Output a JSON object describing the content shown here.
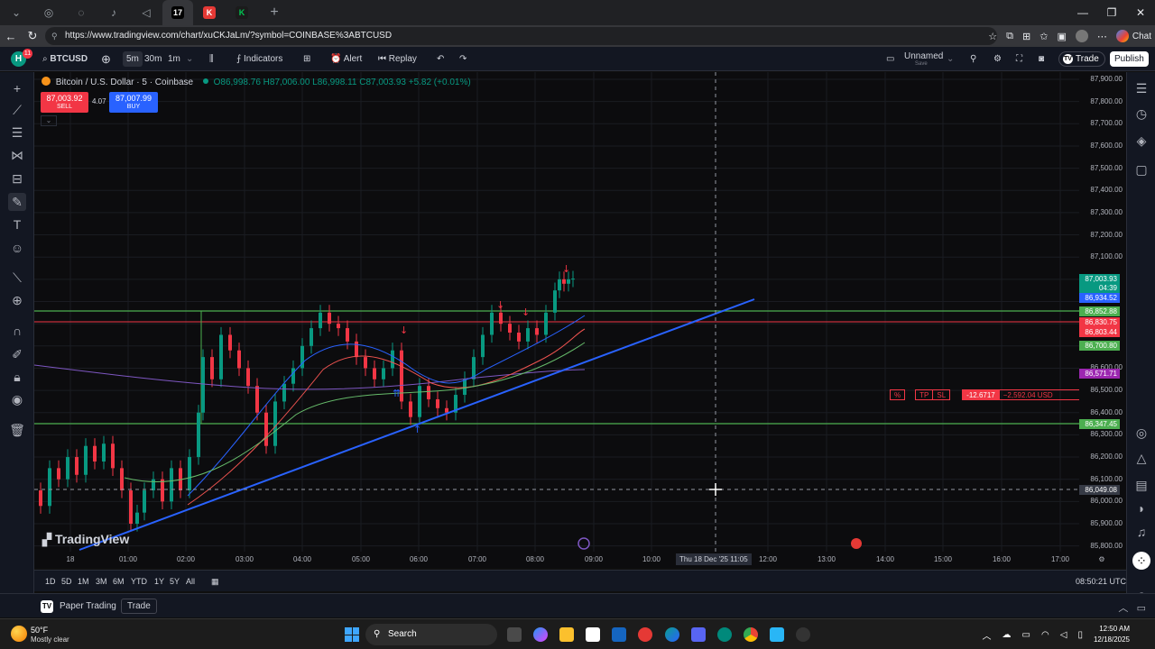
{
  "browser": {
    "tabs": [
      {
        "icon": "chevron-down-icon",
        "label": "⌄"
      },
      {
        "icon": "globe-icon",
        "label": "◎"
      },
      {
        "icon": "globe-icon",
        "label": "◌"
      },
      {
        "icon": "tiktok-icon",
        "label": "♪"
      },
      {
        "icon": "speaker-icon",
        "label": "◁"
      },
      {
        "icon": "tradingview-icon",
        "label": "17",
        "active": true,
        "color": "#131722"
      },
      {
        "icon": "app-icon",
        "label": "K",
        "color": "#e53935"
      },
      {
        "icon": "app-icon",
        "label": "K",
        "color": "#00c853"
      },
      {
        "icon": "plus-icon",
        "label": "+"
      }
    ],
    "url": "https://www.tradingview.com/chart/xuCKJaLm/?symbol=COINBASE%3ABTCUSD",
    "chat_label": "Chat",
    "window": {
      "minimize": "—",
      "restore": "❐",
      "close": "✕"
    }
  },
  "toolbar": {
    "logo_badge": "11",
    "symbol": "BTCUSD",
    "intervals": [
      "5m",
      "30m",
      "1m"
    ],
    "indicators_label": "Indicators",
    "alert_label": "Alert",
    "replay_label": "Replay",
    "layout_name": "Unnamed",
    "layout_sub": "Save",
    "trade_label": "Trade",
    "publish_label": "Publish"
  },
  "legend": {
    "title": "Bitcoin / U.S. Dollar · 5 · Coinbase",
    "ohlc": "O86,998.76 H87,006.00 L86,998.11 C87,003.93 +5.82 (+0.01%)",
    "sell_price": "87,003.92",
    "sell_label": "SELL",
    "spread": "4.07",
    "buy_price": "87,007.99",
    "buy_label": "BUY"
  },
  "watermark": "TradingView",
  "price_axis": {
    "labels": [
      "87,900.00",
      "87,800.00",
      "87,700.00",
      "87,600.00",
      "87,500.00",
      "87,400.00",
      "87,300.00",
      "87,200.00",
      "87,100.00",
      "86,600.00",
      "86,500.00",
      "86,400.00",
      "86,300.00",
      "86,200.00",
      "86,100.00",
      "86,000.00",
      "85,900.00",
      "85,800.00"
    ],
    "tags": [
      {
        "text": "87,003.93",
        "color": "#089981"
      },
      {
        "text": "04:39",
        "color": "#089981"
      },
      {
        "text": "86,934.52",
        "color": "#2962ff"
      },
      {
        "text": "86,852.88",
        "color": "#4caf50"
      },
      {
        "text": "86,830.75",
        "color": "#f23645"
      },
      {
        "text": "86,803.44",
        "color": "#f23645"
      },
      {
        "text": "86,700.80",
        "color": "#4caf50"
      },
      {
        "text": "86,571.71",
        "color": "#9c27b0"
      },
      {
        "text": "86,347.45",
        "color": "#4caf50"
      },
      {
        "text": "86,049.08",
        "color": "#363a45"
      }
    ]
  },
  "time_axis": {
    "labels": [
      "18",
      "01:00",
      "02:00",
      "03:00",
      "04:00",
      "05:00",
      "06:00",
      "07:00",
      "08:00",
      "09:00",
      "10:00",
      "12:00",
      "13:00",
      "14:00",
      "15:00",
      "16:00",
      "17:00"
    ],
    "crosshair": "Thu 18 Dec '25   11:05"
  },
  "position": {
    "pct": "%",
    "tp": "TP",
    "sl": "SL",
    "pnl": "-12.6717",
    "usd": "−2,592.04 USD",
    "close": "✕"
  },
  "ranges": [
    "1D",
    "5D",
    "1M",
    "3M",
    "6M",
    "YTD",
    "1Y",
    "5Y",
    "All"
  ],
  "utc_time": "08:50:21 UTC",
  "panel": {
    "paper_label": "Paper Trading",
    "trade_label": "Trade"
  },
  "taskbar": {
    "temp": "50°F",
    "condition": "Mostly clear",
    "search_label": "Search",
    "time": "12:50 AM",
    "date": "12/18/2025"
  },
  "colors": {
    "up": "#089981",
    "down": "#f23645",
    "trend": "#2962ff",
    "level": "#4caf50",
    "resistance": "#f23645"
  }
}
